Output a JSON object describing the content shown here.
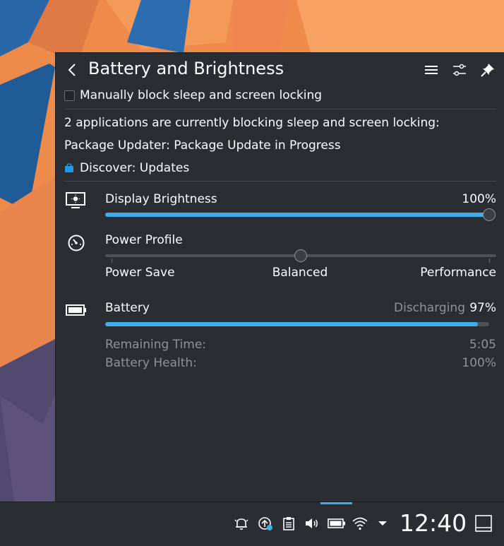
{
  "header": {
    "title": "Battery and Brightness"
  },
  "inhibit": {
    "checkbox_label": "Manually block sleep and screen locking",
    "summary": "2 applications are currently blocking sleep and screen locking:",
    "apps": [
      "Package Updater: Package Update in Progress",
      "Discover: Updates"
    ]
  },
  "brightness": {
    "label": "Display Brightness",
    "value_text": "100%",
    "level": 1.0
  },
  "power_profile": {
    "label": "Power Profile",
    "options": [
      "Power Save",
      "Balanced",
      "Performance"
    ],
    "selected_index": 1
  },
  "battery": {
    "label": "Battery",
    "state": "Discharging",
    "percent_text": "97%",
    "level": 0.97,
    "details": [
      {
        "key": "Remaining Time:",
        "value": "5:05"
      },
      {
        "key": "Battery Health:",
        "value": "100%"
      }
    ]
  },
  "taskbar": {
    "clock": "12:40"
  },
  "colors": {
    "accent": "#3daee9",
    "panel": "#2a2e32",
    "text": "#fcfcfc",
    "dim": "#8f9397"
  },
  "icons": {
    "header": [
      "back-icon",
      "hamburger-menu-icon",
      "configure-icon",
      "pin-icon"
    ],
    "tray": [
      "notifications-icon",
      "updates-icon",
      "clipboard-icon",
      "volume-icon",
      "battery-icon",
      "wifi-icon",
      "expand-arrow-icon"
    ]
  }
}
